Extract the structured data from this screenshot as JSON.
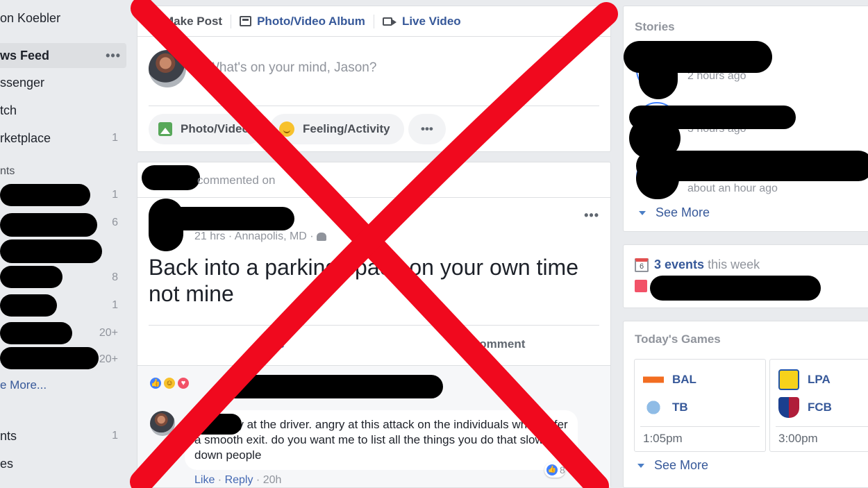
{
  "sidebar": {
    "profile_name": "on Koebler",
    "items": [
      {
        "label": "ws Feed",
        "count": "",
        "active": true
      },
      {
        "label": "ssenger",
        "count": ""
      },
      {
        "label": "tch",
        "count": ""
      },
      {
        "label": "rketplace",
        "count": "1"
      }
    ],
    "section_label": "nts",
    "hidden_counts": [
      "1",
      "6",
      "",
      "8",
      "1",
      "20+",
      "20+"
    ],
    "see_more": "e More...",
    "bottom_items": [
      {
        "label": "nts",
        "count": "1"
      },
      {
        "label": "es",
        "count": ""
      }
    ],
    "more_dots": "•••"
  },
  "composer": {
    "tab_make_post": "Make Post",
    "tab_album": "Photo/Video Album",
    "tab_live": "Live Video",
    "placeholder": "What's on your mind, Jason?",
    "btn_photo": "Photo/Video",
    "btn_feeling": "Feeling/Activity",
    "btn_more": "•••"
  },
  "post": {
    "context": "commented on",
    "meta": "21 hrs · Annapolis, MD · ",
    "more": "•••",
    "text": "Back into a parking space on your own time not mine",
    "action_like": "Like",
    "action_comment": "Comment",
    "comment": {
      "text": "not angry at the driver. angry at this attack on the individuals who prefer a smooth exit. do you want me to list all the things you do that slows down people",
      "reaction_count": "8",
      "like": "Like",
      "reply": "Reply",
      "time": "20h"
    }
  },
  "stories": {
    "title": "Stories",
    "times": [
      "2 hours ago",
      "3 hours ago",
      "about an hour ago"
    ],
    "see_more": "See More"
  },
  "events": {
    "calendar_day": "6",
    "count_text": "3 events",
    "suffix": "this week"
  },
  "games": {
    "title": "Today's Games",
    "list": [
      {
        "team1": "BAL",
        "team2": "TB",
        "time": "1:05pm"
      },
      {
        "team1": "LPA",
        "team2": "FCB",
        "time": "3:00pm"
      }
    ],
    "see_more": "See More"
  },
  "colors": {
    "page_bg": "#e9ebee",
    "link_blue": "#365899",
    "overlay_red": "#f0091e"
  }
}
